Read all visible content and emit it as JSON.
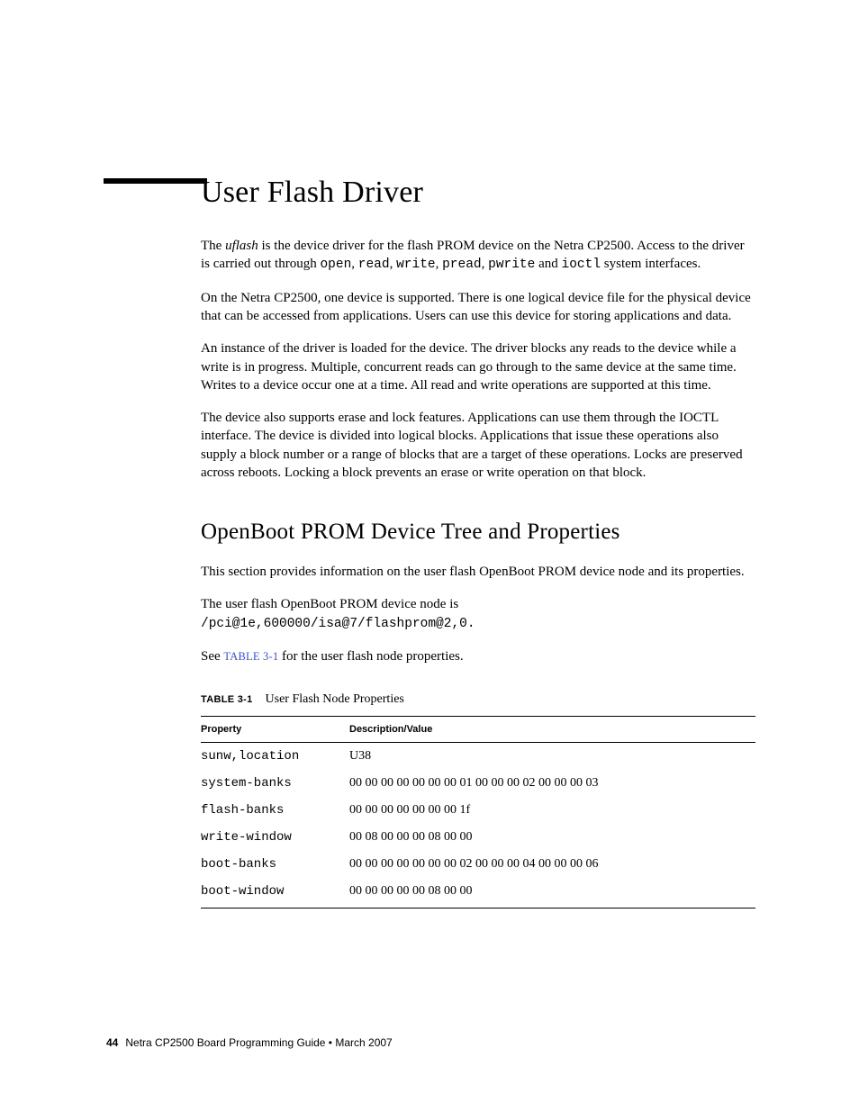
{
  "heading1": "User Flash Driver",
  "p1": {
    "a": "The ",
    "b": "uflash",
    "c": " is the device driver for the flash PROM device on the Netra CP2500. Access to the driver is carried out through ",
    "d": "open",
    "e": ", ",
    "f": "read",
    "g": ", ",
    "h": "write",
    "i": ", ",
    "j": "pread",
    "k": ", ",
    "l": "pwrite",
    "m": " and ",
    "n": "ioctl",
    "o": " system interfaces."
  },
  "p2": "On the Netra CP2500, one device is supported. There is one logical device file for the physical device that can be accessed from applications. Users can use this device for storing applications and data.",
  "p3": "An instance of the driver is loaded for the device. The driver blocks any reads to the device while a write is in progress. Multiple, concurrent reads can go through to the same device at the same time. Writes to a device occur one at a time. All read and write operations are supported at this time.",
  "p4": "The device also supports erase and lock features. Applications can use them through the IOCTL interface. The device is divided into logical blocks. Applications that issue these operations also supply a block number or a range of blocks that are a target of these operations. Locks are preserved across reboots. Locking a block prevents an erase or write operation on that block.",
  "heading2": "OpenBoot PROM Device Tree and Properties",
  "p5": "This section provides information on the user flash OpenBoot PROM device node and its properties.",
  "p6a": "The user flash OpenBoot PROM device node is",
  "p6b": "/pci@1e,600000/isa@7/flashprom@2,0.",
  "p7a": "See ",
  "p7link": "TABLE 3-1",
  "p7b": " for the user flash node properties.",
  "table": {
    "label": "TABLE 3-1",
    "caption": "User Flash Node Properties",
    "headers": {
      "c1": "Property",
      "c2": "Description/Value"
    },
    "rows": [
      {
        "prop": "sunw,location",
        "val": "U38"
      },
      {
        "prop": "system-banks",
        "val": "00 00 00 00 00 00 00 01 00 00 00 02 00 00 00 03"
      },
      {
        "prop": "flash-banks",
        "val": "00 00 00 00 00 00 00 1f"
      },
      {
        "prop": "write-window",
        "val": "00 08 00 00 00 08 00 00"
      },
      {
        "prop": "boot-banks",
        "val": "00 00 00 00 00 00 00 02 00 00 00 04 00 00 00 06"
      },
      {
        "prop": "boot-window",
        "val": "00 00 00 00 00 08 00 00"
      }
    ]
  },
  "footer": {
    "page": "44",
    "text": "Netra CP2500 Board Programming Guide  •  March 2007"
  }
}
